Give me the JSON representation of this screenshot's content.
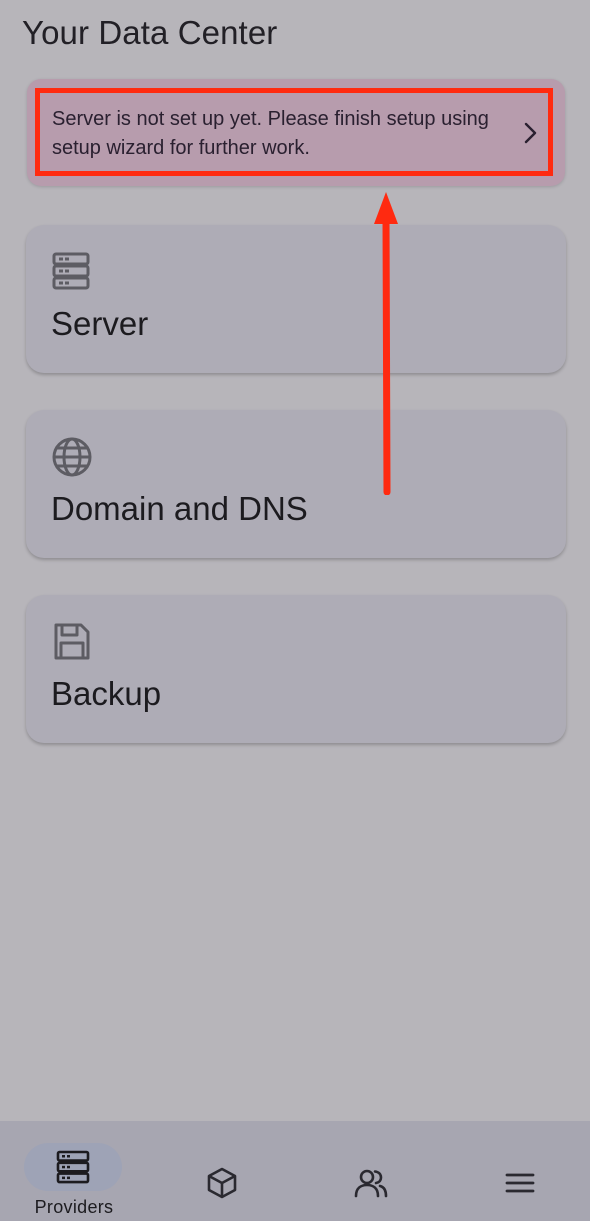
{
  "header": {
    "title": "Your Data Center"
  },
  "banner": {
    "message": "Server is not set up yet. Please finish setup using setup wizard for further work."
  },
  "cards": [
    {
      "label": "Server",
      "icon": "server-icon"
    },
    {
      "label": "Domain and DNS",
      "icon": "globe-icon"
    },
    {
      "label": "Backup",
      "icon": "save-icon"
    }
  ],
  "bottom_nav": {
    "items": [
      {
        "label": "Providers",
        "icon": "server-icon",
        "selected": true
      },
      {
        "label": "",
        "icon": "cube-icon",
        "selected": false
      },
      {
        "label": "",
        "icon": "users-icon",
        "selected": false
      },
      {
        "label": "",
        "icon": "menu-icon",
        "selected": false
      }
    ]
  },
  "colors": {
    "background": "#b7b5ba",
    "banner": "#b79cad",
    "card": "#aeacb6",
    "annotation": "#ff2a10",
    "nav": "#a7a6b1"
  }
}
